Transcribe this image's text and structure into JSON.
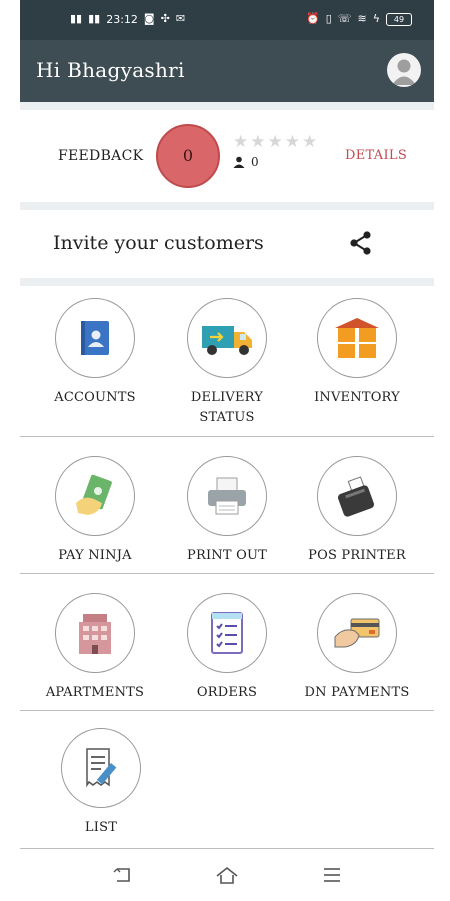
{
  "status_bar": {
    "time": "23:12",
    "left_icons": [
      "signal-icon",
      "signal-icon",
      "whatsapp-icon",
      "usb-icon",
      "gmail-icon"
    ],
    "right_icons": [
      "alarm-icon",
      "vibrate-icon",
      "volte-icon",
      "wifi-icon",
      "charging-icon"
    ],
    "battery": "49"
  },
  "app_bar": {
    "title": "Hi Bhagyashri",
    "avatar_icon": "user-avatar-icon"
  },
  "feedback": {
    "label": "FEEDBACK",
    "score": "0",
    "rating": 0,
    "rating_max": 5,
    "reviewer_count": "0",
    "details_label": "DETAILS"
  },
  "invite": {
    "text": "Invite your customers",
    "share_icon": "share-icon"
  },
  "grid": {
    "row1": [
      {
        "label_line1": "ACCOUNTS",
        "label_line2": "",
        "icon": "accounts-book-icon"
      },
      {
        "label_line1": "DELIVERY",
        "label_line2": "STATUS",
        "icon": "delivery-truck-icon"
      },
      {
        "label_line1": "INVENTORY",
        "label_line2": "",
        "icon": "inventory-boxes-icon"
      }
    ],
    "row2": [
      {
        "label_line1": "PAY NINJA",
        "label_line2": "",
        "icon": "pay-cash-icon"
      },
      {
        "label_line1": "PRINT OUT",
        "label_line2": "",
        "icon": "printer-icon"
      },
      {
        "label_line1": "POS PRINTER",
        "label_line2": "",
        "icon": "pos-printer-icon"
      }
    ],
    "row3": [
      {
        "label_line1": "APARTMENTS",
        "label_line2": "",
        "icon": "apartment-building-icon"
      },
      {
        "label_line1": "ORDERS",
        "label_line2": "",
        "icon": "orders-checklist-icon"
      },
      {
        "label_line1": "DN PAYMENTS",
        "label_line2": "",
        "icon": "card-payment-icon"
      }
    ],
    "row4": [
      {
        "label_line1": "LIST",
        "label_line2": "",
        "icon": "list-receipt-icon"
      }
    ]
  },
  "nav": {
    "icons": [
      "back-icon",
      "home-icon",
      "menu-icon"
    ]
  },
  "colors": {
    "app_bar": "#3e4c53",
    "status_bar": "#2f3d45",
    "score_circle": "#d9676a",
    "details": "#c24a52"
  }
}
